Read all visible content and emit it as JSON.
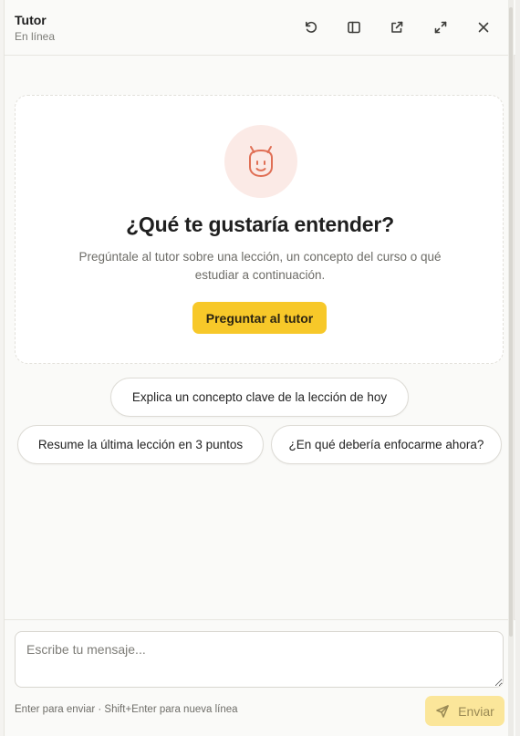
{
  "header": {
    "title": "Tutor",
    "status": "En línea",
    "icons": [
      "reset-icon",
      "sidebar-icon",
      "external-link-icon",
      "expand-icon",
      "close-icon"
    ]
  },
  "hero": {
    "avatar_icon": "tutor-face-icon",
    "title": "¿Qué te gustaría entender?",
    "description": "Pregúntale al tutor sobre una lección, un concepto del curso o qué estudiar a continuación.",
    "cta_label": "Preguntar al tutor"
  },
  "suggestions": [
    "Explica un concepto clave de la lección de hoy",
    "Resume la última lección en 3 puntos",
    "¿En qué debería enfocarme ahora?"
  ],
  "composer": {
    "placeholder": "Escribe tu mensaje...",
    "value": "",
    "hint": "Enter para enviar · Shift+Enter para nueva línea",
    "send_label": "Enviar",
    "send_icon": "send-icon"
  },
  "colors": {
    "accent": "#f7c829",
    "accent_disabled": "#fbe69a",
    "avatar_bg": "#fbeae6",
    "avatar_stroke": "#e06f55"
  }
}
